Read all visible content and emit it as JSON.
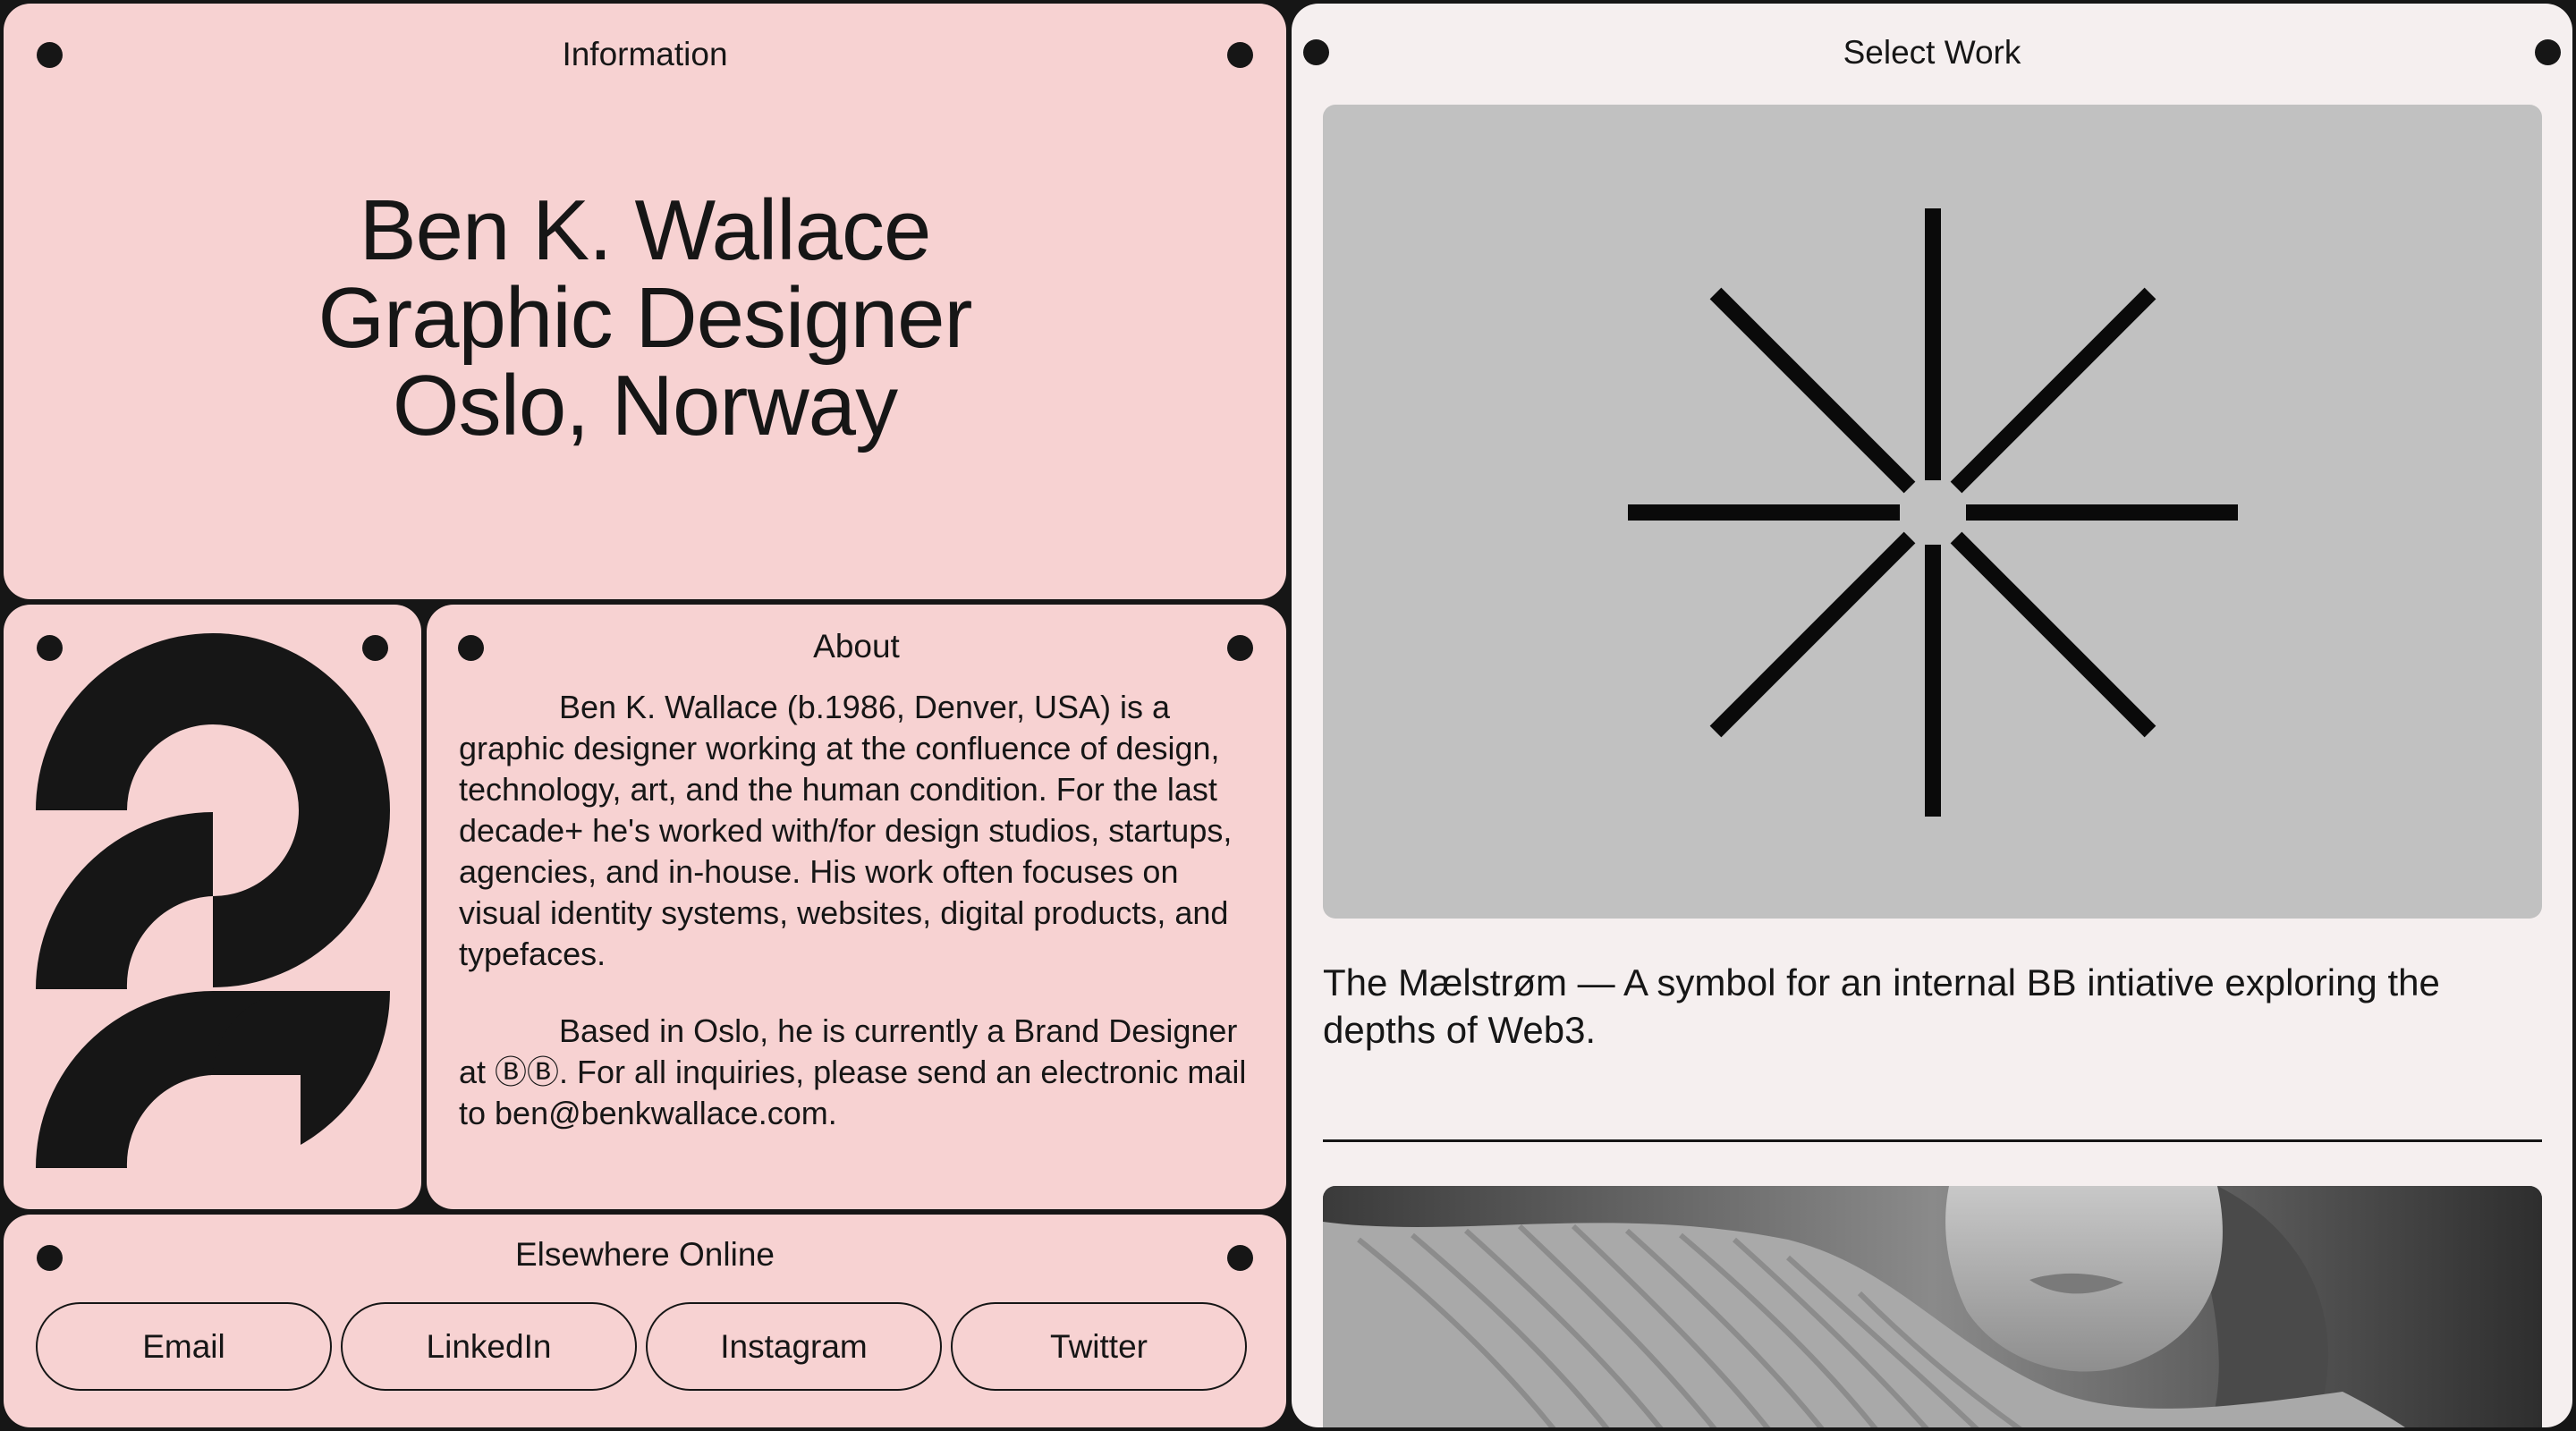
{
  "information": {
    "title": "Information",
    "name": "Ben K. Wallace",
    "role": "Graphic Designer",
    "location": "Oslo, Norway"
  },
  "about": {
    "title": "About",
    "paragraph1": "Ben K. Wallace (b.1986, Denver, USA) is a graphic designer working at the confluence of design, technology, art, and the human condition. For the last decade+ he's worked with/for design studios, startups, agencies, and in-house. His work often focuses on visual identity systems, websites, digital products, and typefaces.",
    "paragraph2": "Based in Oslo, he is currently a Brand Designer at ⒷⒷ. For all inquiries, please send an electronic mail to ben@benkwallace.com."
  },
  "elsewhere": {
    "title": "Elsewhere Online",
    "links": [
      {
        "label": "Email"
      },
      {
        "label": "LinkedIn"
      },
      {
        "label": "Instagram"
      },
      {
        "label": "Twitter"
      }
    ]
  },
  "work": {
    "title": "Select Work",
    "items": [
      {
        "caption": "The Mælstrøm — A symbol for an internal BB intiative exploring the depths of Web3.",
        "image": "starburst-symbol"
      },
      {
        "caption": "",
        "image": "portrait-photo"
      }
    ]
  },
  "colors": {
    "background": "#161616",
    "panel_pink": "#f7d2d2",
    "panel_light": "#f5efef",
    "ink": "#161616",
    "image_gray": "#c1c1c1"
  }
}
